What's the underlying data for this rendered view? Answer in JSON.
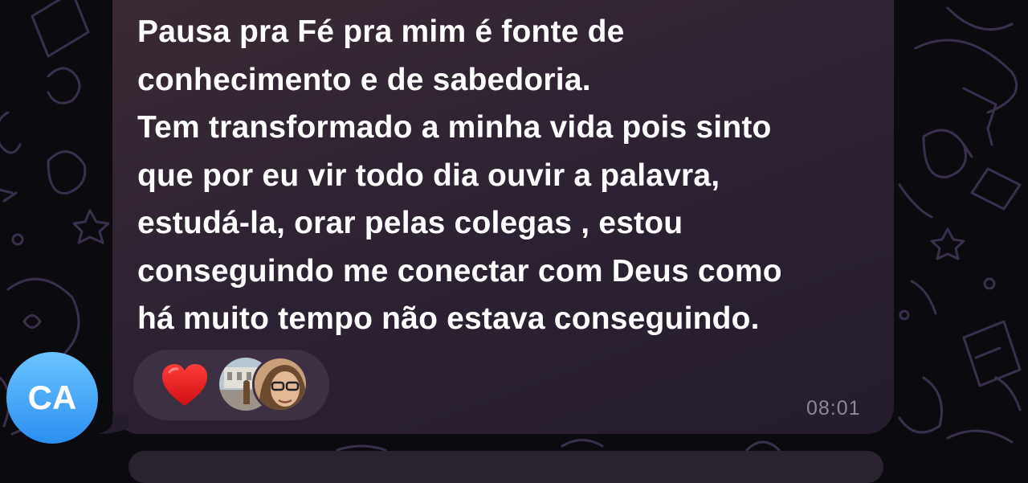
{
  "message": {
    "lines": [
      "Pausa pra Fé pra mim é fonte de",
      "conhecimento e de sabedoria.",
      "Tem transformado a minha vida pois sinto",
      "que por eu vir todo dia ouvir a palavra,",
      "estudá-la, orar pelas colegas , estou",
      "conseguindo me conectar com Deus como",
      "há muito tempo não estava conseguindo."
    ],
    "time": "08:01"
  },
  "reaction": {
    "emoji_name": "red-heart-icon",
    "color": "#e8191b"
  },
  "sender": {
    "initials": "CA",
    "avatar_color": "#3a9df5"
  }
}
